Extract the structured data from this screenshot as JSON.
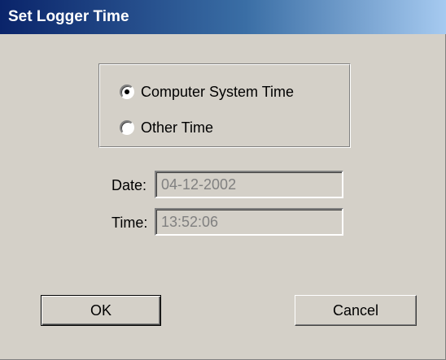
{
  "window": {
    "title": "Set Logger Time"
  },
  "time_source": {
    "options": [
      {
        "label": "Computer System Time",
        "selected": true
      },
      {
        "label": "Other Time",
        "selected": false
      }
    ]
  },
  "fields": {
    "date_label": "Date:",
    "date_value": "04-12-2002",
    "time_label": "Time:",
    "time_value": "13:52:06"
  },
  "buttons": {
    "ok_label": "OK",
    "cancel_label": "Cancel"
  },
  "colors": {
    "titlebar_start": "#0a246a",
    "titlebar_end": "#a6caf0",
    "dialog_face": "#d4d0c8",
    "disabled_text": "#808080"
  },
  "icons": {
    "radio_selected": "radio-selected-icon",
    "radio_unselected": "radio-unselected-icon"
  }
}
